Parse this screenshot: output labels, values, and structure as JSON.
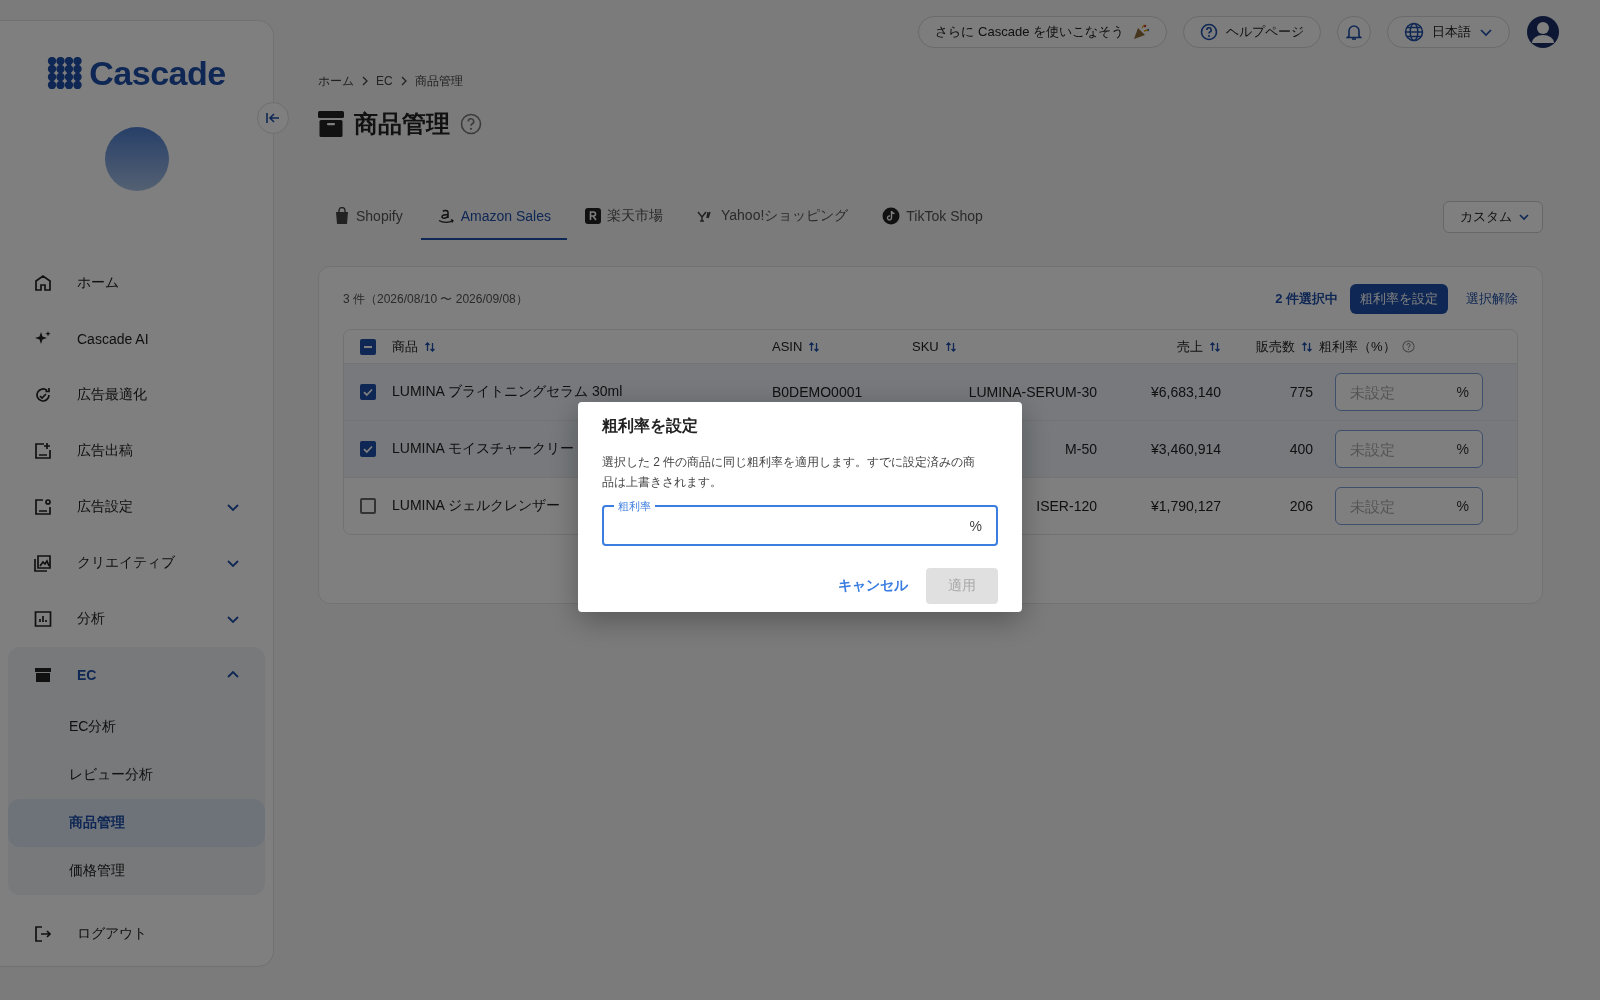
{
  "topbar": {
    "promo": "さらに Cascade を使いこなそう",
    "help": "ヘルプページ",
    "language": "日本語"
  },
  "sidebar": {
    "logo": "Cascade",
    "items": [
      {
        "label": "ホーム",
        "kind": "link"
      },
      {
        "label": "Cascade AI",
        "kind": "link"
      },
      {
        "label": "広告最適化",
        "kind": "link"
      },
      {
        "label": "広告出稿",
        "kind": "link"
      },
      {
        "label": "広告設定",
        "kind": "group",
        "expanded": false
      },
      {
        "label": "クリエイティブ",
        "kind": "group",
        "expanded": false
      },
      {
        "label": "分析",
        "kind": "group",
        "expanded": false
      },
      {
        "label": "EC",
        "kind": "group",
        "expanded": true,
        "children": [
          {
            "label": "EC分析",
            "selected": false
          },
          {
            "label": "レビュー分析",
            "selected": false
          },
          {
            "label": "商品管理",
            "selected": true
          },
          {
            "label": "価格管理",
            "selected": false
          }
        ]
      }
    ],
    "logout": "ログアウト"
  },
  "breadcrumb": [
    "ホーム",
    "EC",
    "商品管理"
  ],
  "page_title": "商品管理",
  "tabs": [
    {
      "label": "Shopify",
      "selected": false
    },
    {
      "label": "Amazon Sales",
      "selected": true
    },
    {
      "label": "楽天市場",
      "selected": false
    },
    {
      "label": "Yahoo!ショッピング",
      "selected": false
    },
    {
      "label": "TikTok Shop",
      "selected": false
    }
  ],
  "view_dropdown": "カスタム",
  "toolbar": {
    "count": "3 件（2026/08/10 〜 2026/09/08）",
    "selected_count": "2 件選択中",
    "set_margin": "粗利率を設定",
    "clear_selection": "選択解除"
  },
  "table": {
    "select_all": {
      "indeterminate": true
    },
    "columns": [
      {
        "label": "商品",
        "kind": "sort"
      },
      {
        "label": "ASIN",
        "kind": "sort"
      },
      {
        "label": "SKU",
        "kind": "sort"
      },
      {
        "label": "売上",
        "kind": "sort"
      },
      {
        "label": "販売数",
        "kind": "sort"
      },
      {
        "label": "粗利率（%）",
        "kind": "help"
      }
    ],
    "rows": [
      {
        "selected": true,
        "product": "LUMINA ブライトニングセラム 30ml",
        "asin": "B0DEMO0001",
        "sku": "LUMINA-SERUM-30",
        "sales": "¥6,683,140",
        "units": "775",
        "margin_placeholder": "未設定",
        "margin_unit": "%"
      },
      {
        "selected": true,
        "product": "LUMINA モイスチャークリー",
        "sku": "M-50",
        "sales": "¥3,460,914",
        "units": "400",
        "margin_placeholder": "未設定",
        "margin_unit": "%"
      },
      {
        "selected": false,
        "product": "LUMINA ジェルクレンザー",
        "sku": "ISER-120",
        "sales": "¥1,790,127",
        "units": "206",
        "margin_placeholder": "未設定",
        "margin_unit": "%"
      }
    ]
  },
  "dialog": {
    "title": "粗利率を設定",
    "message": "選択した 2 件の商品に同じ粗利率を適用します。すでに設定済みの商品は上書きされます。",
    "field_label": "粗利率",
    "field_unit": "%",
    "field_focused": true,
    "cancel": "キャンセル",
    "apply": "適用",
    "apply_disabled": true
  }
}
